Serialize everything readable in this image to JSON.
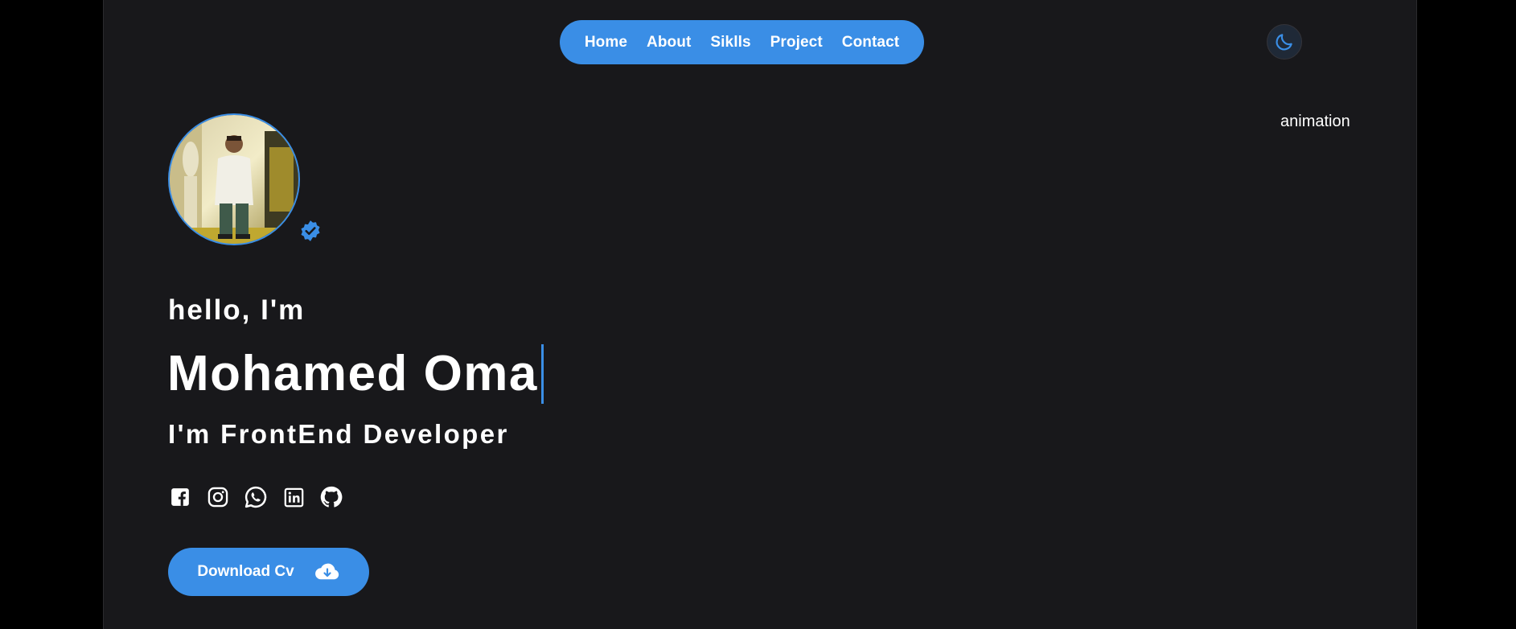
{
  "nav": {
    "items": [
      {
        "label": "Home"
      },
      {
        "label": "About"
      },
      {
        "label": "Siklls"
      },
      {
        "label": "Project"
      },
      {
        "label": "Contact"
      }
    ]
  },
  "theme_toggle": {
    "icon": "moon-icon"
  },
  "animation_label": "animation",
  "hero": {
    "avatar": "avatar",
    "badge_icon": "verified-badge-icon",
    "greeting": "hello, I'm",
    "name": "Mohamed Oma",
    "role": "I'm FrontEnd Developer",
    "socials": [
      {
        "icon": "facebook-icon"
      },
      {
        "icon": "instagram-icon"
      },
      {
        "icon": "whatsapp-icon"
      },
      {
        "icon": "linkedin-icon"
      },
      {
        "icon": "github-icon"
      }
    ],
    "download_label": "Download Cv",
    "download_icon": "cloud-download-icon"
  },
  "colors": {
    "accent": "#3a8ee6",
    "background": "#18181b",
    "outer": "#000000",
    "text": "#ffffff"
  }
}
